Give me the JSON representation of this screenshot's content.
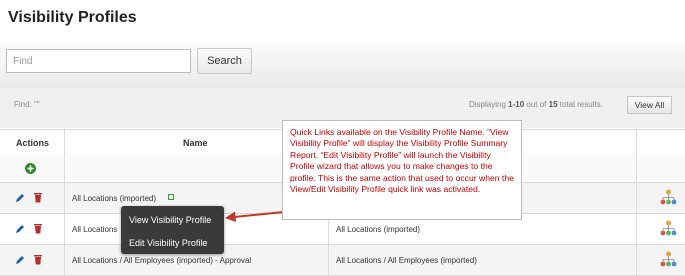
{
  "page": {
    "title": "Visibility Profiles"
  },
  "search": {
    "placeholder": "Find",
    "button_label": "Search"
  },
  "results": {
    "find_label": "Find: \"\"",
    "display_prefix": "Displaying ",
    "display_range": "1-10",
    "display_mid": " out of ",
    "display_total": "15",
    "display_suffix": " total results.",
    "view_all_label": "View All"
  },
  "table": {
    "headers": {
      "actions": "Actions",
      "name": "Name"
    },
    "rows": [
      {
        "name": "All Locations (imported)",
        "has_quicklink": true,
        "col3": ""
      },
      {
        "name": "All Locations",
        "has_quicklink": false,
        "col3": "All Locations (imported)"
      },
      {
        "name": "All Locations / All Employees (imported) - Approval",
        "has_quicklink": false,
        "col3": "All Locations / All Employees (imported)"
      }
    ]
  },
  "quicklink_menu": {
    "items": [
      "View Visibility Profile",
      "Edit Visibility Profile"
    ]
  },
  "callout": {
    "text": "Quick Links available on the Visibility Profile Name. “View Visibility Profile” will display the Visibility Profile Summary Report. “Edit Visibility Profile” will launch the Visibility Profile wizard that allows you to make changes to the profile. This is the same action that used to occur when the View/Edit Visibility Profile quick link was activated."
  },
  "colors": {
    "callout_text": "#c00000",
    "arrow": "#c0392b",
    "add_icon": "#2e8b2e",
    "edit_icon": "#1f5fa8",
    "delete_icon": "#b03030"
  },
  "icons": {
    "add": "plus-circle-icon",
    "edit": "pencil-icon",
    "delete": "trash-icon",
    "hierarchy": "org-chart-icon",
    "quicklink": "quicklink-dot-icon"
  }
}
